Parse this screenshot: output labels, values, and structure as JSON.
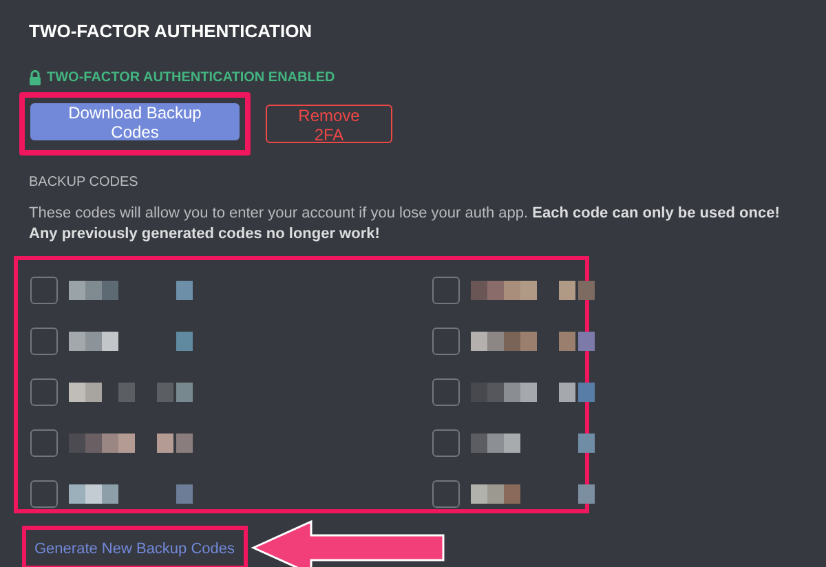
{
  "title": "TWO-FACTOR AUTHENTICATION",
  "status": "TWO-FACTOR AUTHENTICATION ENABLED",
  "buttons": [
    {
      "label": "Download Backup Codes",
      "kind": "primary"
    },
    {
      "label": "Remove 2FA",
      "kind": "danger"
    }
  ],
  "backup_codes": {
    "heading": "BACKUP CODES",
    "description": "These codes will allow you to enter your account if you lose your auth app. **Each code can only be used once! Any previously generated codes no longer work!**",
    "codes": [
      {
        "checked": false
      },
      {
        "checked": false
      },
      {
        "checked": false
      },
      {
        "checked": false
      },
      {
        "checked": false
      },
      {
        "checked": false
      },
      {
        "checked": false
      },
      {
        "checked": false
      },
      {
        "checked": false
      },
      {
        "checked": false
      }
    ]
  },
  "link": "Generate New Backup Codes"
}
